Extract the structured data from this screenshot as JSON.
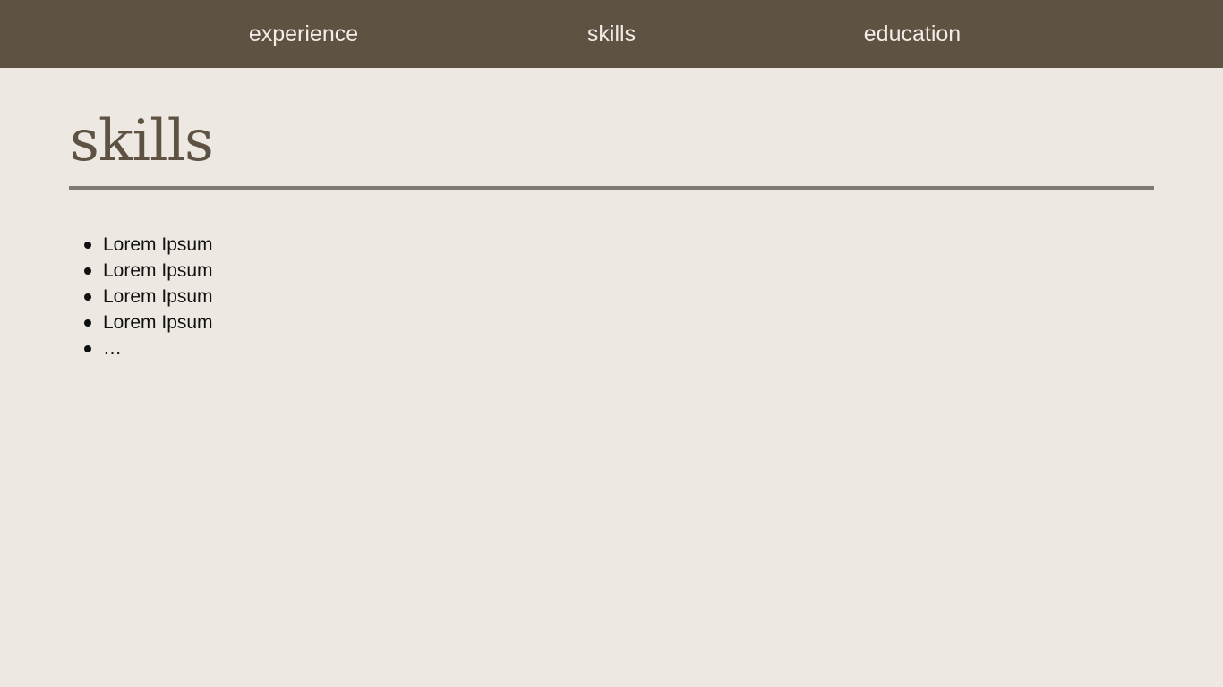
{
  "nav": {
    "items": [
      {
        "label": "experience"
      },
      {
        "label": "skills"
      },
      {
        "label": "education"
      }
    ]
  },
  "main": {
    "title": "skills",
    "skills": [
      "Lorem Ipsum",
      "Lorem Ipsum",
      "Lorem Ipsum",
      "Lorem Ipsum",
      "…"
    ]
  },
  "colors": {
    "nav_background": "#5e5242",
    "page_background": "#ede8e2",
    "title_color": "#5e5242",
    "divider_color": "#7e7a76"
  }
}
